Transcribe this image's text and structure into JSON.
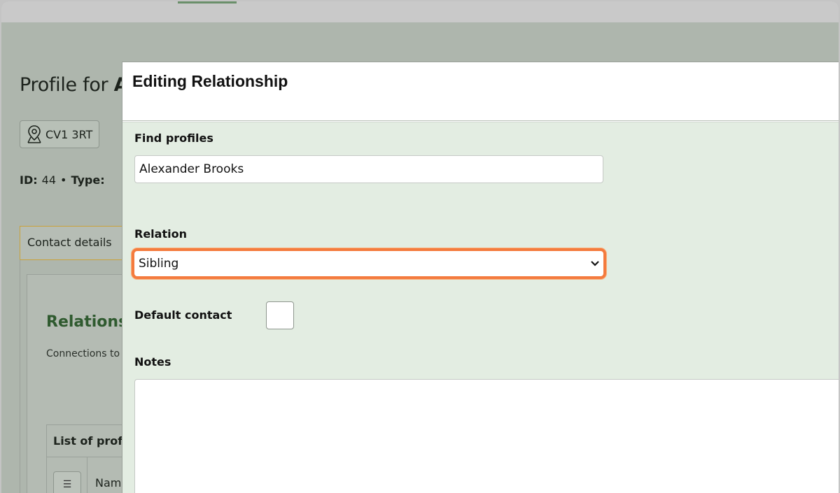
{
  "background_page": {
    "title_prefix": "Profile for",
    "title_name_visible": "A",
    "postcode": "CV1 3RT",
    "id_label": "ID:",
    "id_value": "44",
    "separator": "•",
    "type_label": "Type:",
    "tab_contact_details": "Contact details",
    "relations_heading": "Relations",
    "connections_text": "Connections to",
    "list_title": "List of prof",
    "menu_glyph": "☰",
    "name_column": "Nam"
  },
  "modal": {
    "title": "Editing Relationship",
    "find_profiles_label": "Find profiles",
    "find_profiles_value": "Alexander Brooks",
    "relation_label": "Relation",
    "relation_value": "Sibling",
    "default_contact_label": "Default contact",
    "default_contact_checked": false,
    "notes_label": "Notes",
    "notes_value": ""
  },
  "colors": {
    "overlay": "#aeb6ad",
    "modal_body": "#e3ede2",
    "highlight_outline": "#f47b3e",
    "heading_green": "#2f5a2f"
  }
}
